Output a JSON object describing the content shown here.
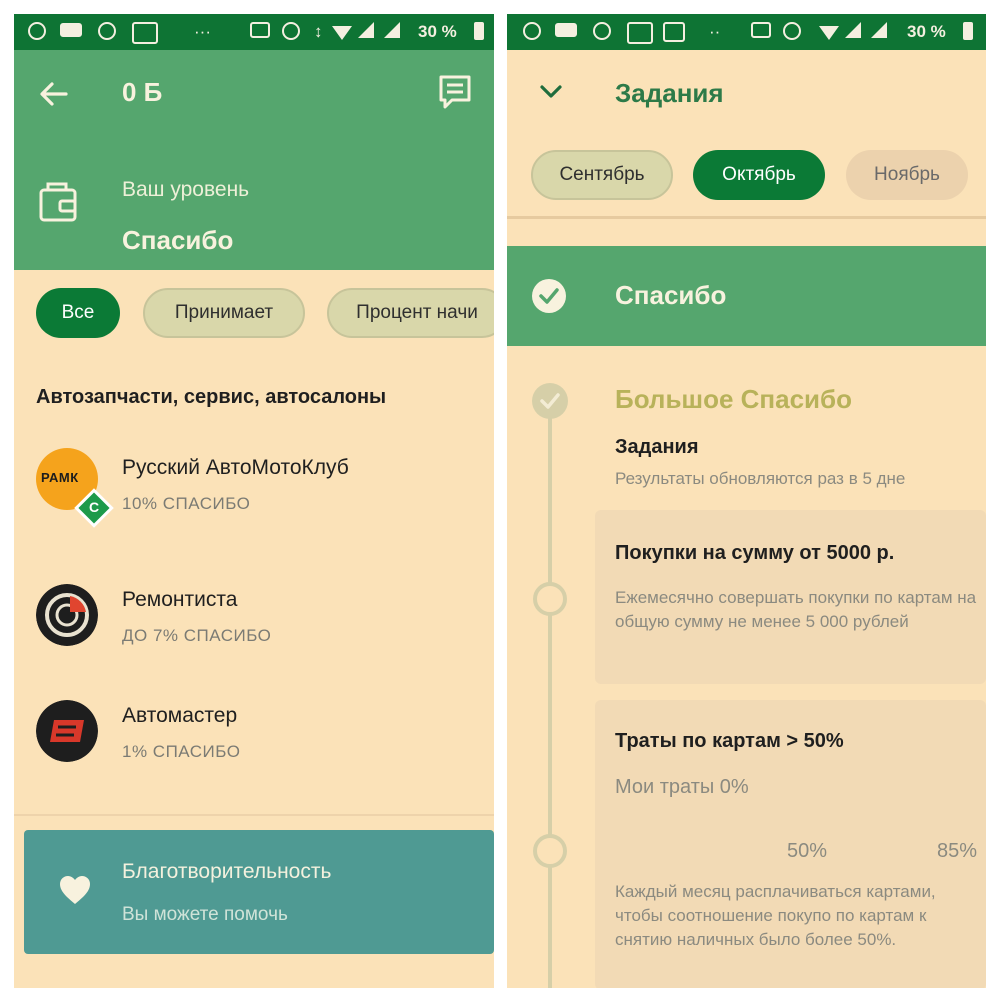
{
  "left": {
    "status": {
      "battery": "30 %",
      "dots": "···"
    },
    "header": {
      "title": "0 Б",
      "level_label": "Ваш уровень",
      "level_value": "Спасибо"
    },
    "filters": [
      {
        "label": "Все",
        "active": true
      },
      {
        "label": "Принимает",
        "active": false
      },
      {
        "label": "Процент начи",
        "active": false
      }
    ],
    "section_title": "Автозапчасти, сервис, автосалоны",
    "merchants": [
      {
        "name": "Русский АвтоМотоКлуб",
        "bonus": "10% СПАСИБО",
        "logo_text": "РАМК",
        "badge": "С"
      },
      {
        "name": "Ремонтиста",
        "bonus": "ДО 7% СПАСИБО"
      },
      {
        "name": "Автомастер",
        "bonus": "1% СПАСИБО"
      }
    ],
    "charity": {
      "title": "Благотворительность",
      "subtitle": "Вы можете помочь"
    }
  },
  "right": {
    "status": {
      "battery": "30 %",
      "dots": "··"
    },
    "header": {
      "title": "Задания"
    },
    "months": [
      {
        "label": "Сентябрь",
        "state": "inactive"
      },
      {
        "label": "Октябрь",
        "state": "active"
      },
      {
        "label": "Ноябрь",
        "state": "muted"
      }
    ],
    "level_done": "Спасибо",
    "level_next": "Большое Спасибо",
    "tasks_label": "Задания",
    "tasks_note": "Результаты обновляются раз в 5 дне",
    "tasks": [
      {
        "title": "Покупки на сумму от 5000 р.",
        "desc": "Ежемесячно совершать покупки по картам на общую сумму не менее 5 000 рублей"
      },
      {
        "title": "Траты по картам > 50%",
        "spending": "Мои траты 0%",
        "mark_1": "50%",
        "mark_2": "85%",
        "desc": "Каждый месяц расплачиваться картами, чтобы соотношение покупо по картам к снятию наличных было более 50%."
      }
    ]
  },
  "colors": {
    "status_bar": "#0e7434",
    "header": "#55a66e",
    "background": "#fbe2b8",
    "active_chip": "#0b7a36",
    "charity": "#4f9a93",
    "level_gold": "#b8b25a"
  }
}
